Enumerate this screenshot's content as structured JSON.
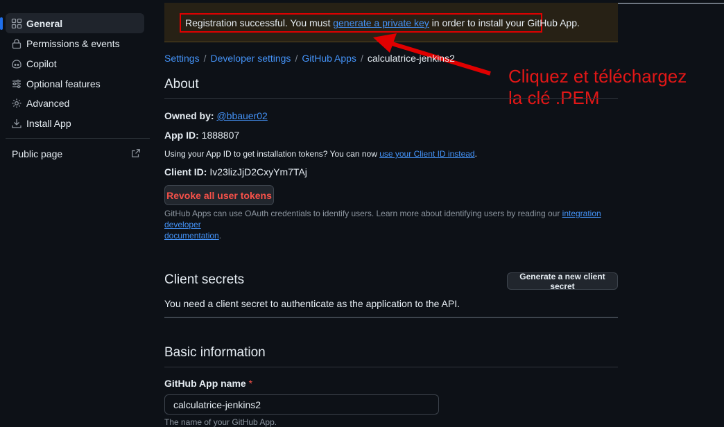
{
  "sidebar": {
    "items": [
      {
        "label": "General",
        "icon": "apps-icon",
        "active": true
      },
      {
        "label": "Permissions & events",
        "icon": "lock-icon"
      },
      {
        "label": "Copilot",
        "icon": "copilot-icon"
      },
      {
        "label": "Optional features",
        "icon": "sliders-icon"
      },
      {
        "label": "Advanced",
        "icon": "gear-icon"
      },
      {
        "label": "Install App",
        "icon": "download-icon"
      }
    ],
    "public_page": {
      "label": "Public page",
      "icon": "external-link-icon"
    }
  },
  "flash": {
    "prefix": "Registration successful. You must ",
    "link": "generate a private key",
    "suffix": " in order to install your GitHub App."
  },
  "annotation": {
    "line1": "Cliquez et téléchargez",
    "line2": "la clé .PEM",
    "color": "#e21717"
  },
  "breadcrumb": [
    {
      "label": "Settings"
    },
    {
      "label": "Developer settings"
    },
    {
      "label": "GitHub Apps"
    },
    {
      "label": "calculatrice-jenkins2",
      "current": true
    }
  ],
  "about": {
    "heading": "About",
    "owned_by_label": "Owned by:",
    "owner": "@bbauer02",
    "app_id_label": "App ID:",
    "app_id": "1888807",
    "client_id_note_prefix": "Using your App ID to get installation tokens? You can now ",
    "client_id_note_link": "use your Client ID instead",
    "client_id_note_suffix": ".",
    "client_id_label": "Client ID:",
    "client_id": "Iv23lizJjD2CxyYm7TAj",
    "revoke_button": "Revoke all user tokens",
    "oauth_note_prefix": "GitHub Apps can use OAuth credentials to identify users. Learn more about identifying users by reading our ",
    "oauth_note_link1": "integration developer",
    "oauth_note_link2": "documentation",
    "oauth_note_suffix": "."
  },
  "client_secrets": {
    "heading": "Client secrets",
    "button": "Generate a new client secret",
    "description": "You need a client secret to authenticate as the application to the API."
  },
  "basic_info": {
    "heading": "Basic information",
    "app_name_label": "GitHub App name",
    "required_mark": "*",
    "app_name_value": "calculatrice-jenkins2",
    "app_name_hint": "The name of your GitHub App."
  },
  "colors": {
    "link": "#4493f8",
    "danger": "#f85149",
    "highlight_border": "#e00000",
    "background": "#0d1117"
  }
}
